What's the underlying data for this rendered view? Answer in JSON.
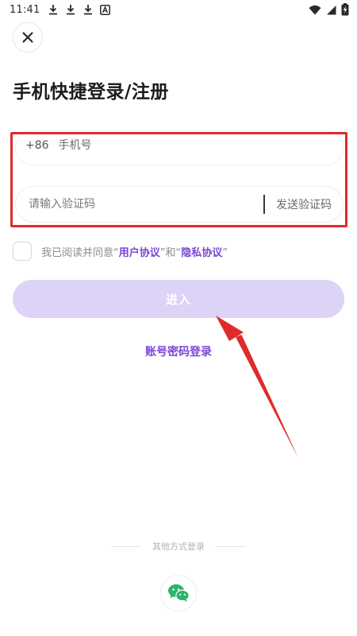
{
  "status_bar": {
    "time": "11:41",
    "left_icons": [
      "download-icon",
      "download-icon",
      "download-icon",
      "app-a-icon"
    ],
    "right_icons": [
      "wifi-icon",
      "signal-icon",
      "battery-charging-icon"
    ]
  },
  "header": {
    "close_icon": "close-icon",
    "title": "手机快捷登录/注册"
  },
  "form": {
    "country_code": "+86",
    "phone_placeholder": "手机号",
    "code_placeholder": "请输入验证码",
    "send_code_label": "发送验证码"
  },
  "agreement": {
    "prefix": "我已阅读并同意",
    "quote_open": "“",
    "user_agreement": "用户协议",
    "quote_close": "”",
    "and": "和",
    "privacy_agreement": "隐私协议"
  },
  "actions": {
    "enter_label": "进入",
    "password_login_label": "账号密码登录"
  },
  "other_login": {
    "label": "其他方式登录",
    "wechat_icon": "wechat-icon"
  },
  "colors": {
    "accent": "#7b45d6",
    "enter_button_bg": "#dcd3f7",
    "annotation_red": "#e02b2b",
    "wechat_green": "#2bb56b"
  }
}
